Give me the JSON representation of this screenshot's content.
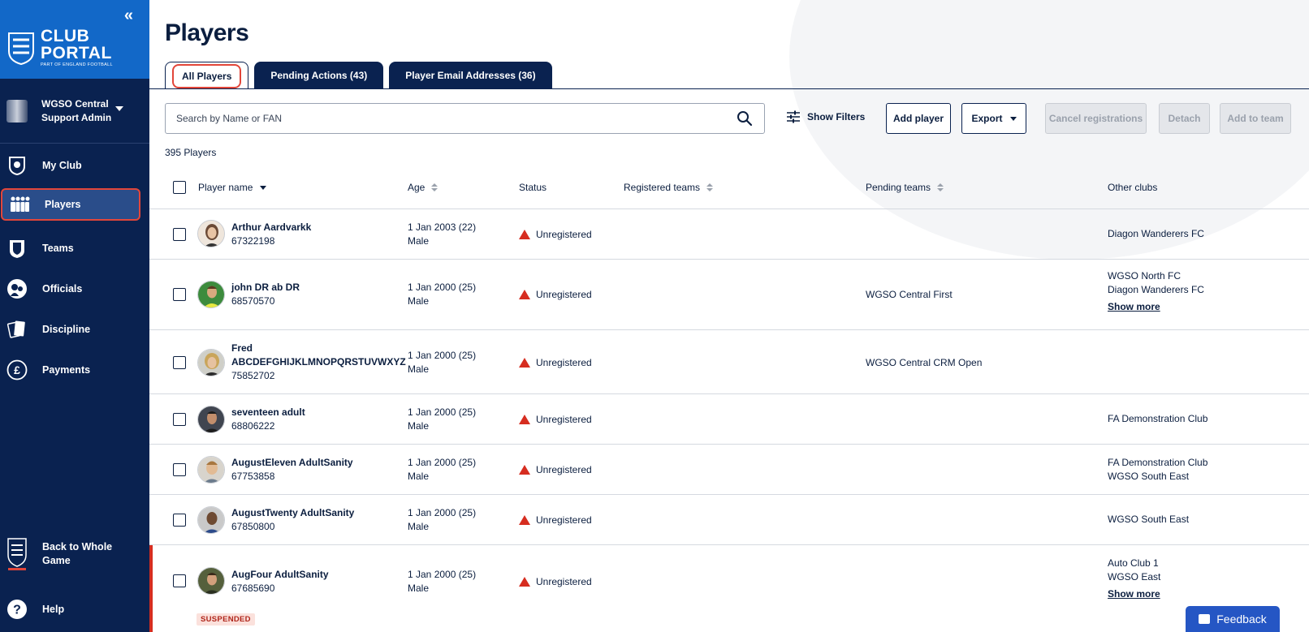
{
  "sidebar": {
    "logo": {
      "line1": "CLUB",
      "line2": "PORTAL",
      "tagline": "PART OF ENGLAND FOOTBALL"
    },
    "org": {
      "line1": "WGSO Central",
      "line2": "Support Admin"
    },
    "nav": [
      {
        "label": "My Club",
        "icon": "club-badge-icon"
      },
      {
        "label": "Players",
        "icon": "players-icon",
        "active": true
      },
      {
        "label": "Teams",
        "icon": "shirt-icon"
      },
      {
        "label": "Officials",
        "icon": "whistle-icon"
      },
      {
        "label": "Discipline",
        "icon": "card-icon"
      },
      {
        "label": "Payments",
        "icon": "pound-icon"
      }
    ],
    "back": {
      "line1": "Back to Whole",
      "line2": "Game"
    },
    "help": "Help"
  },
  "page": {
    "title": "Players",
    "tabs": [
      {
        "label": "All Players",
        "active": true
      },
      {
        "label": "Pending Actions (43)"
      },
      {
        "label": "Player Email Addresses (36)"
      }
    ]
  },
  "toolbar": {
    "search_placeholder": "Search by Name or FAN",
    "show_filters": "Show Filters",
    "add_player": "Add player",
    "export": "Export",
    "cancel_registrations": "Cancel registrations",
    "detach": "Detach",
    "add_to_team": "Add to team"
  },
  "count": "395 Players",
  "table": {
    "headers": {
      "player_name": "Player name",
      "age": "Age",
      "status": "Status",
      "registered_teams": "Registered teams",
      "pending_teams": "Pending teams",
      "other_clubs": "Other clubs"
    },
    "rows": [
      {
        "name": "Arthur Aardvarkk",
        "fan": "67322198",
        "dob": "1 Jan 2003 (22)",
        "gender": "Male",
        "status": "Unregistered",
        "pending": "",
        "other": [
          "Diagon Wanderers FC"
        ]
      },
      {
        "name": "john DR ab DR",
        "fan": "68570570",
        "dob": "1 Jan 2000 (25)",
        "gender": "Male",
        "status": "Unregistered",
        "pending": "WGSO Central First",
        "other": [
          "WGSO North FC",
          "Diagon Wanderers FC"
        ],
        "show_more": "Show more"
      },
      {
        "name": "Fred",
        "name2": "ABCDEFGHIJKLMNOPQRSTUVWXYZ",
        "fan": "75852702",
        "dob": "1 Jan 2000 (25)",
        "gender": "Male",
        "status": "Unregistered",
        "pending": "WGSO Central CRM Open",
        "other": []
      },
      {
        "name": "seventeen adult",
        "fan": "68806222",
        "dob": "1 Jan 2000 (25)",
        "gender": "Male",
        "status": "Unregistered",
        "pending": "",
        "other": [
          "FA Demonstration Club"
        ]
      },
      {
        "name": "AugustEleven AdultSanity",
        "fan": "67753858",
        "dob": "1 Jan 2000 (25)",
        "gender": "Male",
        "status": "Unregistered",
        "pending": "",
        "other": [
          "FA Demonstration Club",
          "WGSO South East"
        ]
      },
      {
        "name": "AugustTwenty AdultSanity",
        "fan": "67850800",
        "dob": "1 Jan 2000 (25)",
        "gender": "Male",
        "status": "Unregistered",
        "pending": "",
        "other": [
          "WGSO South East"
        ]
      },
      {
        "name": "AugFour AdultSanity",
        "fan": "67685690",
        "dob": "1 Jan 2000 (25)",
        "gender": "Male",
        "status": "Unregistered",
        "pending": "",
        "other": [
          "Auto Club 1",
          "WGSO East"
        ],
        "show_more": "Show more",
        "badge": "SUSPENDED"
      }
    ]
  },
  "feedback": "Feedback",
  "colors": {
    "navy": "#0a2250",
    "blue": "#1268c8",
    "red": "#d62d20",
    "highlight": "#e2463a",
    "feedback": "#2556c4"
  }
}
